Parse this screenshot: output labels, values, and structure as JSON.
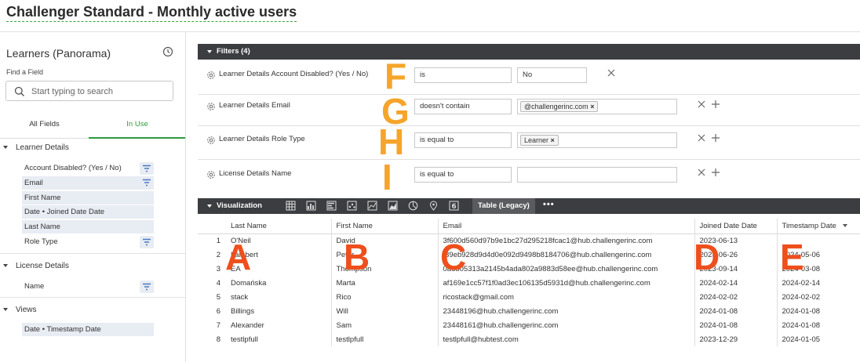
{
  "page": {
    "title": "Challenger Standard - Monthly active users"
  },
  "sidebar": {
    "title": "Learners (Panorama)",
    "find_label": "Find a Field",
    "search_placeholder": "Start typing to search",
    "tabs": [
      "All Fields",
      "In Use"
    ],
    "active_tab": "In Use",
    "groups": [
      {
        "label": "Learner Details",
        "fields": [
          "Account Disabled? (Yes / No)",
          "Email",
          "First Name",
          "Date • Joined Date Date",
          "Last Name",
          "Role Type"
        ]
      },
      {
        "label": "License Details",
        "fields": [
          "Name"
        ]
      },
      {
        "label": "Views",
        "fields": [
          "Date • Timestamp Date"
        ]
      }
    ]
  },
  "filters": {
    "header": "Filters (4)",
    "rows": [
      {
        "name": "Learner Details Account Disabled? (Yes / No)",
        "operator": "is",
        "value": "No"
      },
      {
        "name": "Learner Details Email",
        "operator": "doesn't contain",
        "chip": "@challengerinc.com"
      },
      {
        "name": "Learner Details Role Type",
        "operator": "is equal to",
        "chip": "Learner"
      },
      {
        "name": "License Details Name",
        "operator": "is equal to",
        "value": ""
      }
    ]
  },
  "visualization": {
    "header": "Visualization",
    "icons": [
      "table-icon",
      "bar-chart-icon",
      "column-chart-icon",
      "scatter-icon",
      "line-chart-icon",
      "area-chart-icon",
      "pie-chart-icon",
      "map-pin-icon",
      "single-value-icon"
    ],
    "active_tab": "Table (Legacy)",
    "more": "•••",
    "columns": [
      "Last Name",
      "First Name",
      "Email",
      "Joined Date Date",
      "Timestamp Date"
    ],
    "rows": [
      [
        "1",
        "O'Neil",
        "David",
        "3f600d560d97b9e1bc27d295218fcac1@hub.challengerinc.com",
        "2023-06-13",
        ""
      ],
      [
        "2",
        "Lambert",
        "Peter",
        "f39eb928d9d4d0e092d9498b8184706@hub.challengerinc.com",
        "2023-06-26",
        "2024-05-06"
      ],
      [
        "3",
        "EA",
        "Thompson",
        "0a6505313a2145b4ada802a9883d58ee@hub.challengerinc.com",
        "2023-09-14",
        "2024-03-08"
      ],
      [
        "4",
        "Domańska",
        "Marta",
        "af169e1cc57f1f0ad3ec106135d5931d@hub.challengerinc.com",
        "2024-02-14",
        "2024-02-14"
      ],
      [
        "5",
        "stack",
        "Rico",
        "ricostack@gmail.com",
        "2024-02-02",
        "2024-02-02"
      ],
      [
        "6",
        "Billings",
        "Will",
        "23448196@hub.challengerinc.com",
        "2024-01-08",
        "2024-01-08"
      ],
      [
        "7",
        "Alexander",
        "Sam",
        "23448161@hub.challengerinc.com",
        "2024-01-08",
        "2024-01-08"
      ],
      [
        "8",
        "testlpfull",
        "testlpfull",
        "testlpfull@hubtest.com",
        "2023-12-29",
        "2024-01-05"
      ]
    ]
  },
  "annotations": {
    "filter_letters": [
      "F",
      "G",
      "H",
      "I"
    ],
    "column_letters": [
      "A",
      "B",
      "C",
      "D",
      "E"
    ],
    "orange": "#f5a52b",
    "red": "#ee4f1c"
  },
  "colors": {
    "accent": "#2e9a3e",
    "bar": "#3c3d40"
  }
}
